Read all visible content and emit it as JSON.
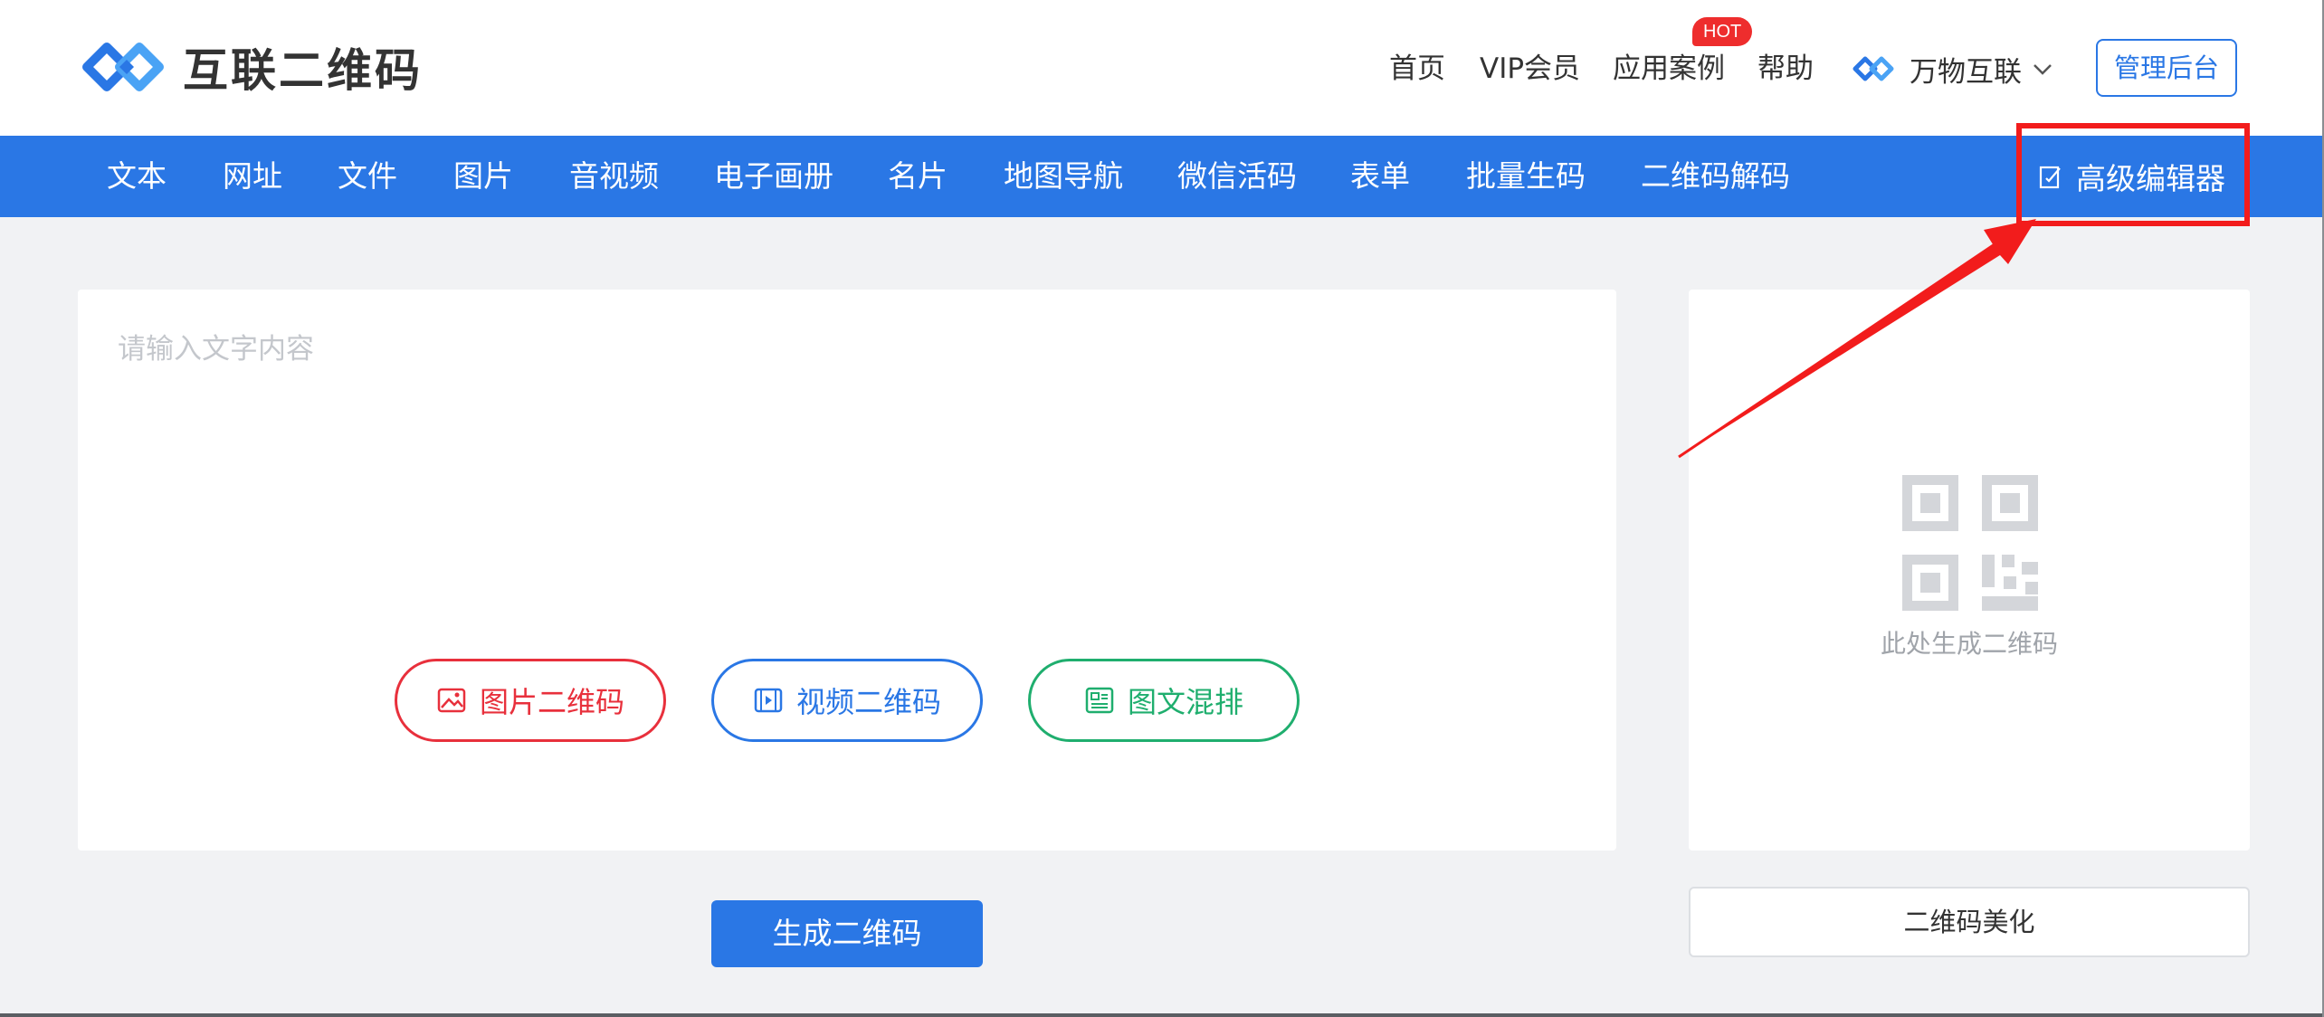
{
  "header": {
    "logo_text": "互联二维码",
    "nav": [
      {
        "id": "home",
        "label": "首页"
      },
      {
        "id": "vip",
        "label": "VIP会员"
      },
      {
        "id": "cases",
        "label": "应用案例"
      },
      {
        "id": "help",
        "label": "帮助"
      }
    ],
    "hot_badge": "HOT",
    "brand_link": "万物互联",
    "admin_button": "管理后台"
  },
  "tabs": [
    "文本",
    "网址",
    "文件",
    "图片",
    "音视频",
    "电子画册",
    "名片",
    "地图导航",
    "微信活码",
    "表单",
    "批量生码",
    "二维码解码"
  ],
  "advanced_editor": "高级编辑器",
  "editor": {
    "placeholder": "请输入文字内容",
    "buttons": {
      "image_qr": "图片二维码",
      "video_qr": "视频二维码",
      "mixed_layout": "图文混排"
    },
    "generate_button": "生成二维码"
  },
  "preview": {
    "hint": "此处生成二维码",
    "beautify_button": "二维码美化"
  },
  "icons": {
    "logo": "chain-link-logo-icon",
    "brand": "chain-link-icon",
    "dropdown": "chevron-down-icon",
    "editor": "edit-icon",
    "image": "image-icon",
    "video": "video-icon",
    "mixed": "article-icon",
    "qr": "qr-code-icon"
  },
  "colors": {
    "primary": "#2a77e5",
    "danger": "#e8303c",
    "success": "#1fae6e",
    "hot_badge": "#ee2d2d",
    "annotation": "#f21c1c",
    "background": "#f1f2f4"
  }
}
